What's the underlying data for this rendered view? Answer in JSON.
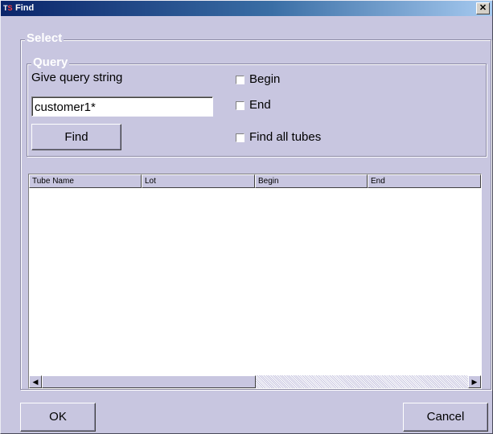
{
  "window": {
    "title": "Find",
    "icon_text_t": "T",
    "icon_text_s": "S",
    "close_glyph": "✕"
  },
  "select_group": {
    "legend": "Select"
  },
  "query_group": {
    "legend": "Query",
    "prompt": "Give query string"
  },
  "query_input": {
    "value": "customer1*"
  },
  "find_button": {
    "label": "Find"
  },
  "options": {
    "begin": {
      "label": "Begin",
      "checked": false
    },
    "end": {
      "label": "End",
      "checked": false
    },
    "find_all_tubes": {
      "label": "Find all tubes",
      "checked": false
    }
  },
  "results_table": {
    "columns": [
      "Tube Name",
      "Lot",
      "Begin",
      "End"
    ],
    "rows": []
  },
  "scrollbar": {
    "left_glyph": "◀",
    "right_glyph": "▶"
  },
  "footer": {
    "ok_label": "OK",
    "cancel_label": "Cancel"
  },
  "colors": {
    "dialog_bg": "#c8c6e0",
    "titlebar_start": "#0a246a",
    "titlebar_end": "#a6caf0",
    "legend_text": "#ffffff"
  }
}
